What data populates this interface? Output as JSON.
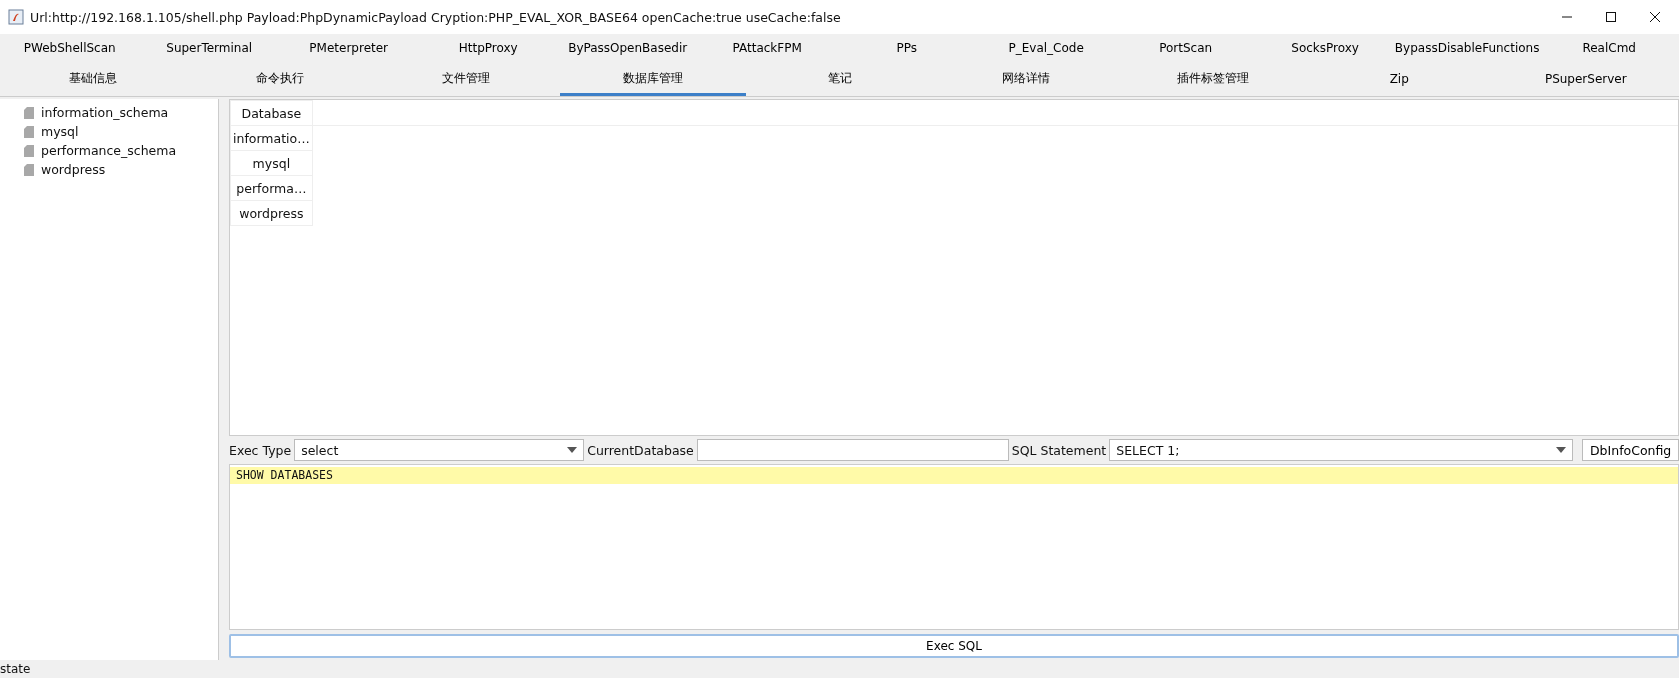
{
  "window": {
    "title": "Url:http://192.168.1.105/shell.php Payload:PhpDynamicPayload Cryption:PHP_EVAL_XOR_BASE64 openCache:true useCache:false"
  },
  "plugin_tabs": [
    {
      "label": "PWebShellScan",
      "selected": false
    },
    {
      "label": "SuperTerminal",
      "selected": false
    },
    {
      "label": "PMeterpreter",
      "selected": false
    },
    {
      "label": "HttpProxy",
      "selected": false
    },
    {
      "label": "ByPassOpenBasedir",
      "selected": false
    },
    {
      "label": "PAttackFPM",
      "selected": false
    },
    {
      "label": "PPs",
      "selected": false
    },
    {
      "label": "P_Eval_Code",
      "selected": false
    },
    {
      "label": "PortScan",
      "selected": false
    },
    {
      "label": "SocksProxy",
      "selected": false
    },
    {
      "label": "BypassDisableFunctions",
      "selected": false
    },
    {
      "label": "RealCmd",
      "selected": false
    }
  ],
  "tabs": [
    {
      "label": "基础信息",
      "selected": false
    },
    {
      "label": "命令执行",
      "selected": false
    },
    {
      "label": "文件管理",
      "selected": false
    },
    {
      "label": "数据库管理",
      "selected": true
    },
    {
      "label": "笔记",
      "selected": false
    },
    {
      "label": "网络详情",
      "selected": false
    },
    {
      "label": "插件标签管理",
      "selected": false
    },
    {
      "label": "Zip",
      "selected": false
    },
    {
      "label": "PSuperServer",
      "selected": false
    }
  ],
  "tree": {
    "items": [
      {
        "label": "information_schema"
      },
      {
        "label": "mysql"
      },
      {
        "label": "performance_schema"
      },
      {
        "label": "wordpress"
      }
    ]
  },
  "table": {
    "columns": [
      "Database"
    ],
    "rows": [
      [
        "informatio…"
      ],
      [
        "mysql"
      ],
      [
        "performa…"
      ],
      [
        "wordpress"
      ]
    ]
  },
  "controls": {
    "exec_type_label": "Exec Type",
    "exec_type": "select",
    "current_database_label": "CurrentDatabase",
    "sql_statement_label": "SQL Statement",
    "sql_statement": "SELECT 1;",
    "config_button": "DbInfoConfig"
  },
  "editor": {
    "lines": [
      {
        "text": "SHOW DATABASES",
        "current": true
      }
    ]
  },
  "exec_button": "Exec SQL",
  "status_bar": "state"
}
